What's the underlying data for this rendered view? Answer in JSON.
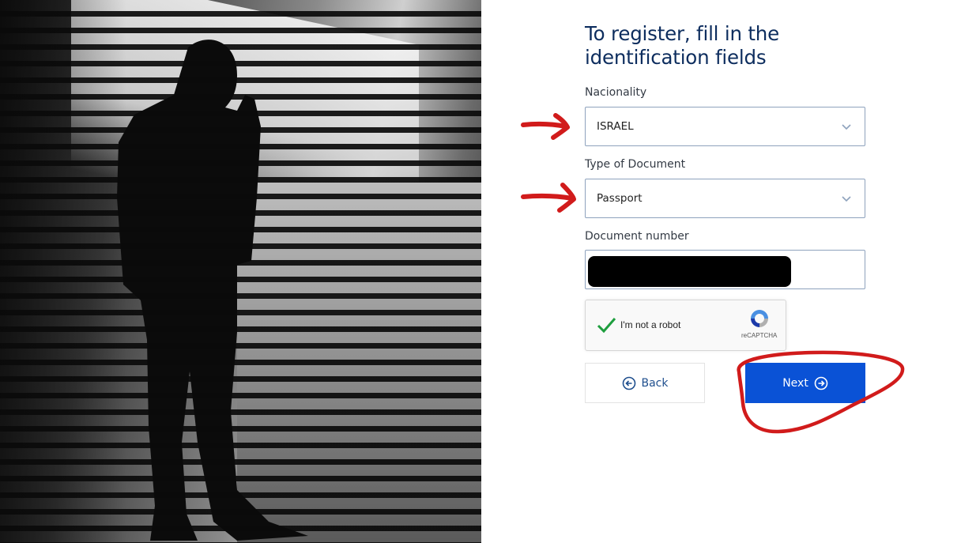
{
  "form": {
    "title": "To register, fill in the identification fields",
    "nationality": {
      "label": "Nacionality",
      "value": "ISRAEL"
    },
    "document_type": {
      "label": "Type of Document",
      "value": "Passport"
    },
    "document_number": {
      "label": "Document number",
      "value": ""
    }
  },
  "captcha": {
    "label": "I'm not a robot",
    "brand": "reCAPTCHA",
    "checked": true
  },
  "buttons": {
    "back_label": "Back",
    "next_label": "Next"
  },
  "colors": {
    "title": "#0d2d5e",
    "accent": "#0a52d6",
    "annotation": "#d11b1b",
    "check": "#1e9e3e"
  },
  "icons": {
    "select_arrow": "chevron-down-icon",
    "back": "arrow-circle-left-icon",
    "next": "arrow-circle-right-icon",
    "captcha": "recaptcha-logo-icon"
  }
}
